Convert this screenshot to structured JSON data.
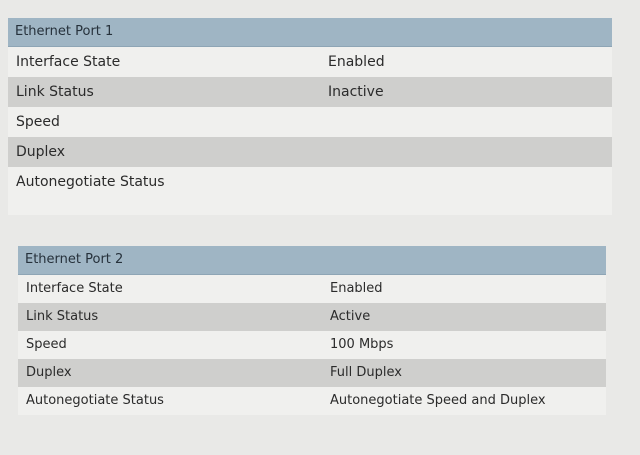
{
  "ports": [
    {
      "title": "Ethernet Port 1",
      "rows": [
        {
          "label": "Interface State",
          "value": "Enabled"
        },
        {
          "label": "Link Status",
          "value": "Inactive"
        },
        {
          "label": "Speed",
          "value": ""
        },
        {
          "label": "Duplex",
          "value": ""
        },
        {
          "label": "Autonegotiate Status",
          "value": ""
        }
      ]
    },
    {
      "title": "Ethernet Port 2",
      "rows": [
        {
          "label": "Interface State",
          "value": "Enabled"
        },
        {
          "label": "Link Status",
          "value": "Active"
        },
        {
          "label": "Speed",
          "value": "100 Mbps"
        },
        {
          "label": "Duplex",
          "value": "Full Duplex"
        },
        {
          "label": "Autonegotiate Status",
          "value": "Autonegotiate Speed and Duplex"
        }
      ]
    }
  ],
  "colors": {
    "header_bg": "#9fb5c4",
    "shaded_row_bg": "#cfcfcd",
    "page_bg": "#e9e9e7"
  }
}
